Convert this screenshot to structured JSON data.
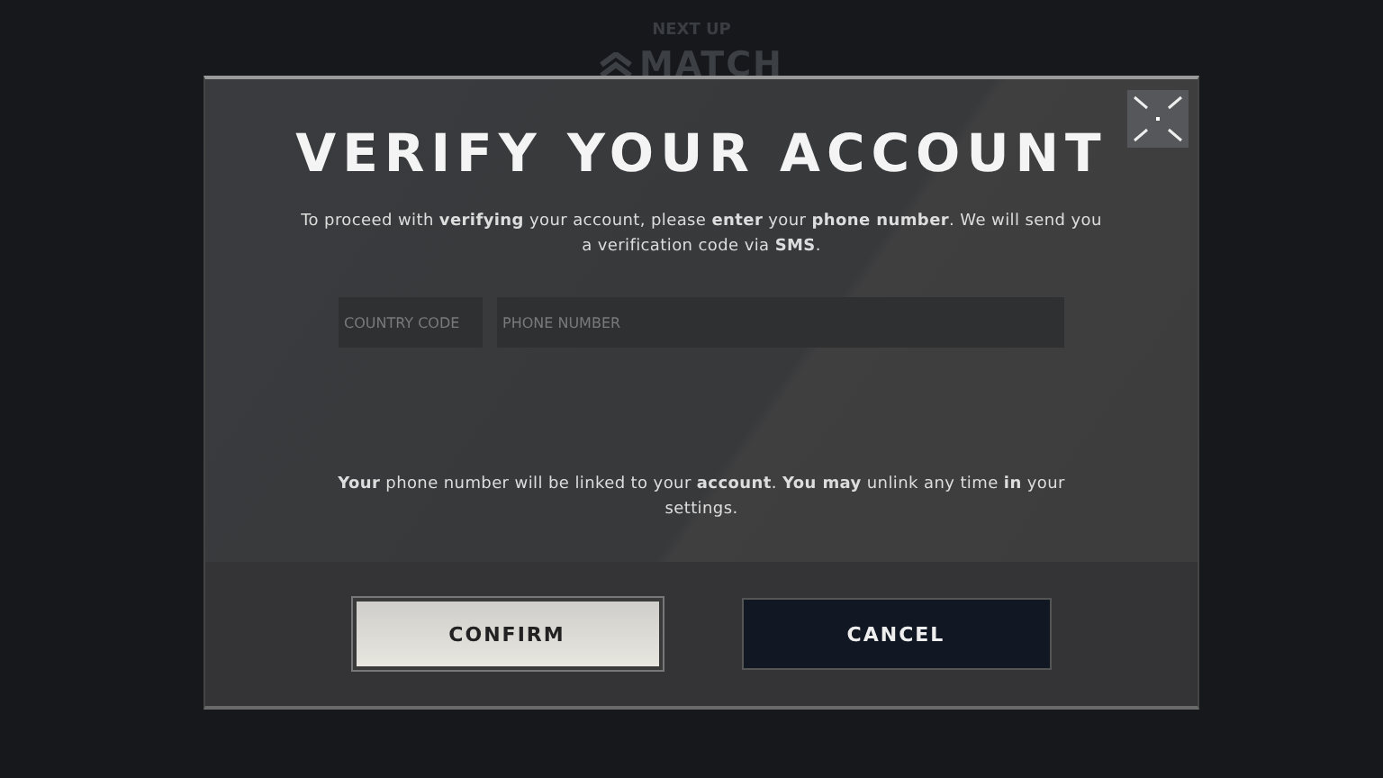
{
  "background": {
    "label": "NEXT UP",
    "mode": "MATCH"
  },
  "dialog": {
    "title": "VERIFY YOUR ACCOUNT",
    "message": "To proceed with **verifying** your account, please **enter** your **phone number**. We will send you a verification code via **SMS**.",
    "fields": [
      {
        "kind": "country",
        "placeholder": "COUNTRY CODE"
      },
      {
        "kind": "phone",
        "placeholder": "PHONE NUMBER"
      }
    ],
    "note": "**Your** phone number will be linked to your **account**. **You may** unlink any time **in** your settings.",
    "buttons": [
      {
        "label": "CONFIRM",
        "kind": "primary"
      },
      {
        "label": "CANCEL",
        "kind": "secondary"
      }
    ]
  }
}
